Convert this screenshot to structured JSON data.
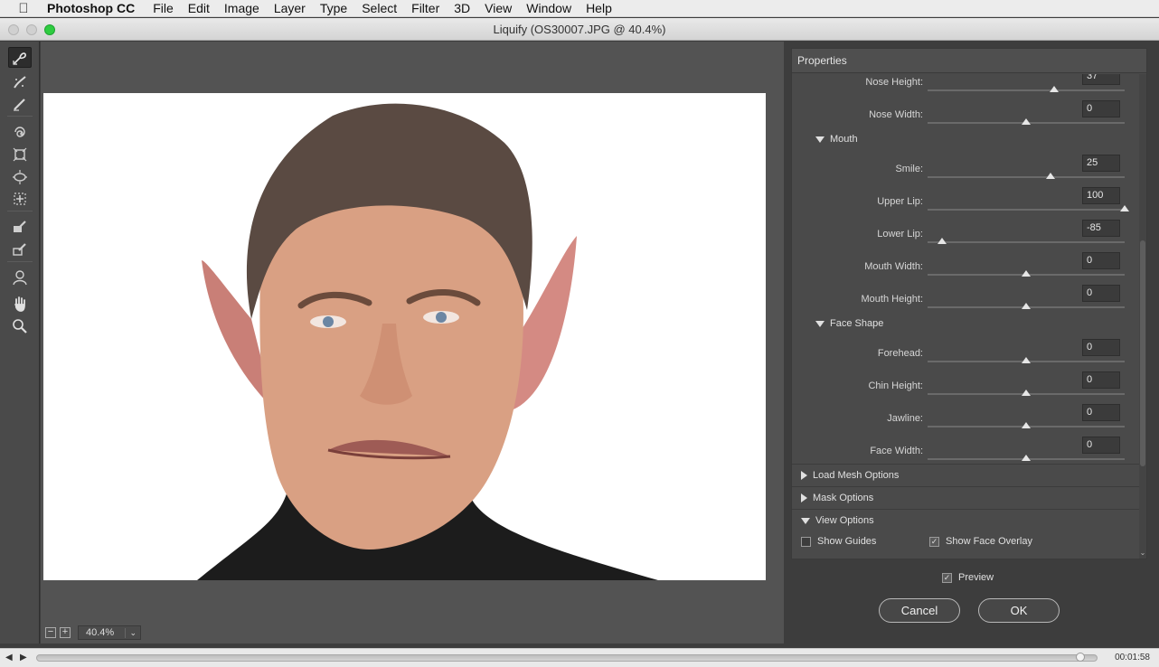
{
  "menubar": {
    "app": "Photoshop CC",
    "items": [
      "File",
      "Edit",
      "Image",
      "Layer",
      "Type",
      "Select",
      "Filter",
      "3D",
      "View",
      "Window",
      "Help"
    ]
  },
  "window": {
    "title": "Liquify (OS30007.JPG @ 40.4%)"
  },
  "toolbar": {
    "tools": [
      "forward-warp-icon",
      "reconstruct-icon",
      "smooth-icon",
      "twirl-icon",
      "pucker-icon",
      "bloat-icon",
      "push-left-icon",
      "freeze-mask-icon",
      "thaw-mask-icon",
      "face-tool-icon",
      "hand-icon",
      "zoom-icon"
    ]
  },
  "canvas": {
    "zoom": "40.4%",
    "zoom_out": "−",
    "zoom_in": "+"
  },
  "panel": {
    "title": "Properties",
    "nose": [
      {
        "label": "Nose Height:",
        "value": "37",
        "level": 0.64
      },
      {
        "label": "Nose Width:",
        "value": "0",
        "level": 0.5
      }
    ],
    "mouth_label": "Mouth",
    "mouth": [
      {
        "label": "Smile:",
        "value": "25",
        "level": 0.625
      },
      {
        "label": "Upper Lip:",
        "value": "100",
        "level": 1.0
      },
      {
        "label": "Lower Lip:",
        "value": "-85",
        "level": 0.075
      },
      {
        "label": "Mouth Width:",
        "value": "0",
        "level": 0.5
      },
      {
        "label": "Mouth Height:",
        "value": "0",
        "level": 0.5
      }
    ],
    "face_shape_label": "Face Shape",
    "face_shape": [
      {
        "label": "Forehead:",
        "value": "0",
        "level": 0.5
      },
      {
        "label": "Chin Height:",
        "value": "0",
        "level": 0.5
      },
      {
        "label": "Jawline:",
        "value": "0",
        "level": 0.5
      },
      {
        "label": "Face Width:",
        "value": "0",
        "level": 0.5
      }
    ],
    "load_mesh": "Load Mesh Options",
    "mask_options": "Mask Options",
    "view_options": "View Options",
    "show_guides": "Show Guides",
    "show_face_overlay": "Show Face Overlay"
  },
  "dialog": {
    "preview": "Preview",
    "cancel": "Cancel",
    "ok": "OK"
  },
  "scrubber": {
    "time": "00:01:58"
  }
}
